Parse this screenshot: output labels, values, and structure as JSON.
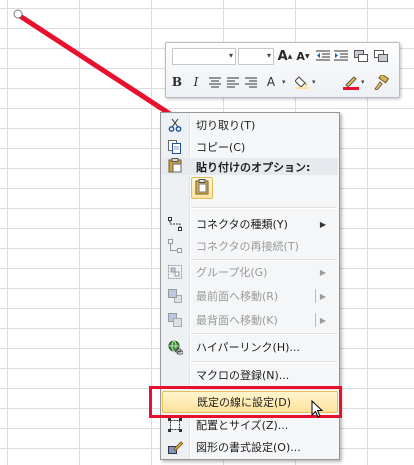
{
  "colors": {
    "connector": "#e8112d",
    "highlight_border": "#e8112d",
    "menu_hover": "#fde39a",
    "underline_color": "#e8112d"
  },
  "mini_toolbar": {
    "font_name_value": "",
    "font_size_value": "",
    "buttons": [
      "grow-font-icon",
      "shrink-font-icon",
      "decrease-indent-icon",
      "increase-indent-icon",
      "merge-cells-icon",
      "bold-icon",
      "italic-icon",
      "align-center-icon",
      "align-left-icon",
      "align-right-icon",
      "font-color-icon",
      "fill-color-icon",
      "line-color-icon",
      "format-painter-icon"
    ]
  },
  "context_menu": {
    "cut": "切り取り(T)",
    "copy": "コピー(C)",
    "paste_options_header": "貼り付けのオプション:",
    "connector_type": "コネクタの種類(Y)",
    "reroute_connector": "コネクタの再接続(T)",
    "group": "グループ化(G)",
    "bring_to_front": "最前面へ移動(R)",
    "send_to_back": "最背面へ移動(K)",
    "hyperlink": "ハイパーリンク(H)...",
    "assign_macro": "マクロの登録(N)...",
    "set_as_default_line": "既定の線に設定(D)",
    "size_and_properties": "配置とサイズ(Z)...",
    "format_shape": "図形の書式設定(O)..."
  }
}
